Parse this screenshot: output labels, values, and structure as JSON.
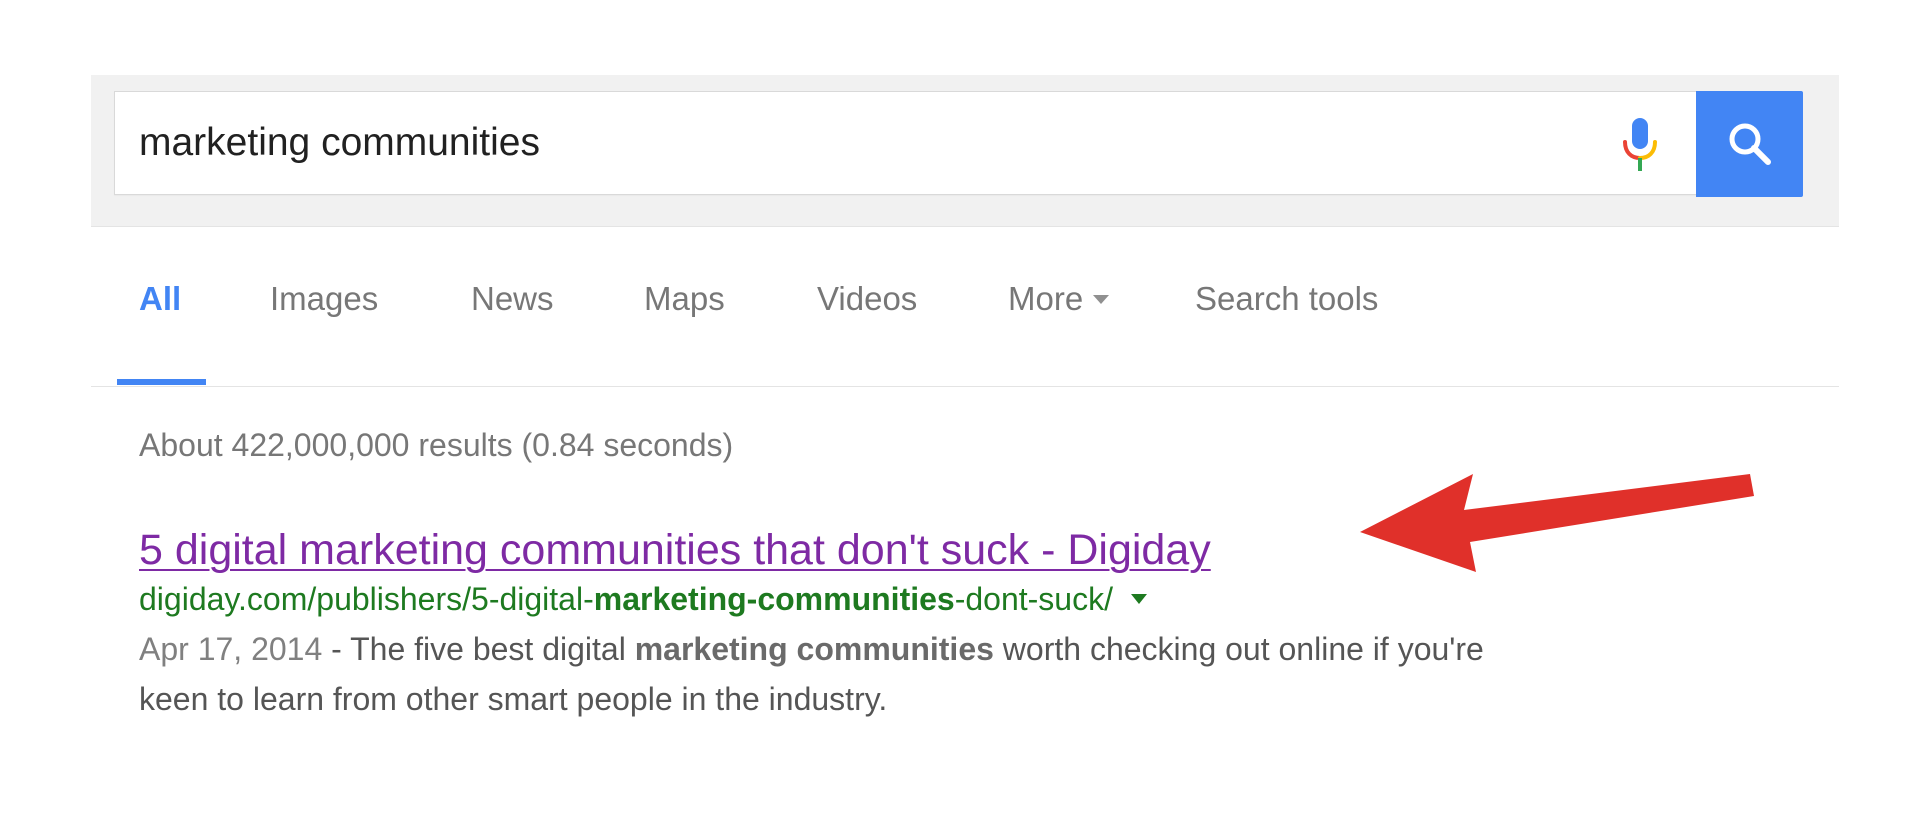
{
  "search": {
    "query": "marketing communities",
    "mic_icon": "microphone-icon",
    "button_icon": "magnifier-icon",
    "button_color": "#4285f4"
  },
  "tabs": [
    {
      "label": "All",
      "active": true
    },
    {
      "label": "Images",
      "active": false
    },
    {
      "label": "News",
      "active": false
    },
    {
      "label": "Maps",
      "active": false
    },
    {
      "label": "Videos",
      "active": false
    },
    {
      "label": "More",
      "active": false,
      "has_dropdown": true
    },
    {
      "label": "Search tools",
      "active": false
    }
  ],
  "results": {
    "stats": "About 422,000,000 results (0.84 seconds)",
    "items": [
      {
        "title": "5 digital marketing communities that don't suck - Digiday",
        "url_parts": [
          {
            "text": "digiday.com/publishers/5-digital-",
            "bold": false
          },
          {
            "text": "marketing-communities",
            "bold": true
          },
          {
            "text": "-dont-suck/",
            "bold": false
          }
        ],
        "date": "Apr 17, 2014",
        "snippet_parts": [
          {
            "text": " - The five best digital ",
            "bold": false
          },
          {
            "text": "marketing communities",
            "bold": true
          },
          {
            "text": " worth checking out online if you're keen to learn from other smart people in the industry.",
            "bold": false
          }
        ]
      }
    ]
  },
  "colors": {
    "active_tab": "#4285f4",
    "visited_link": "#7e2aa4",
    "url_green": "#1e7a20",
    "annotation_arrow": "#e0302a"
  },
  "annotation": {
    "arrow_icon": "red-arrow-icon"
  }
}
